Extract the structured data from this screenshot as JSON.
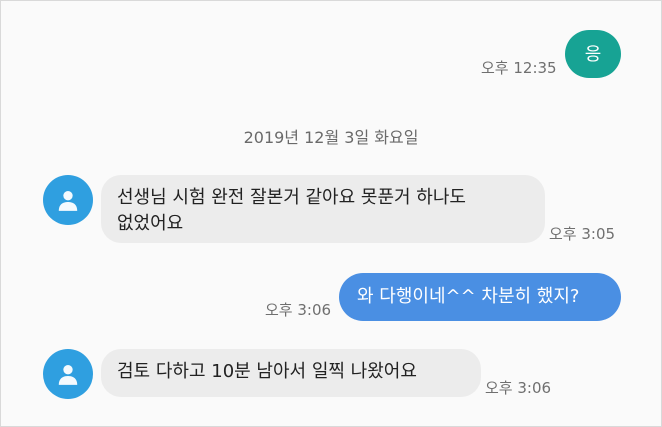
{
  "messages": [
    {
      "id": "m1",
      "direction": "outgoing",
      "text": "응",
      "time": "오후 12:35",
      "color": "#17a394"
    },
    {
      "id": "m2",
      "direction": "incoming",
      "text_lines": [
        "선생님 시험 완전 잘본거 같아요 못푼거 하나도",
        "없었어요"
      ],
      "time": "오후 3:05"
    },
    {
      "id": "m3",
      "direction": "outgoing",
      "text": "와 다행이네^^  차분히 했지?",
      "time": "오후 3:06",
      "color": "#4a8fe3"
    },
    {
      "id": "m4",
      "direction": "incoming",
      "text": "검토 다하고 10분 남아서 일찍 나왔어요",
      "time": "오후 3:06"
    }
  ],
  "date_separator": "2019년 12월 3일 화요일",
  "avatar": {
    "icon": "person-icon",
    "color": "#2f9fe0"
  }
}
